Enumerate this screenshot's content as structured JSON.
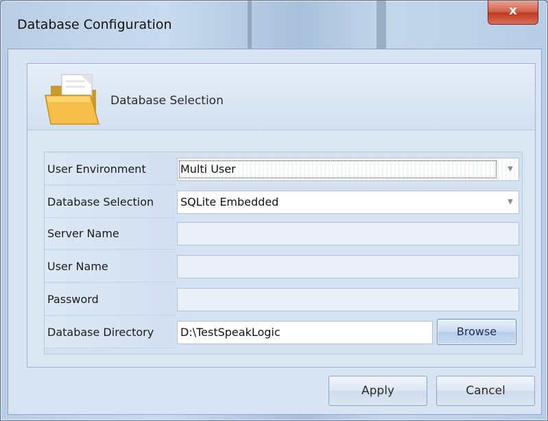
{
  "window": {
    "title": "Database Configuration",
    "close_glyph": "x"
  },
  "group": {
    "title": "Database Selection",
    "icon": "folder-icon"
  },
  "form": {
    "user_environment": {
      "label": "User Environment",
      "value": "Multi User"
    },
    "database_selection": {
      "label": "Database Selection",
      "value": "SQLite Embedded"
    },
    "server_name": {
      "label": "Server Name",
      "value": ""
    },
    "user_name": {
      "label": "User Name",
      "value": ""
    },
    "password": {
      "label": "Password",
      "value": ""
    },
    "database_directory": {
      "label": "Database Directory",
      "value": "D:\\TestSpeakLogic"
    },
    "browse_label": "Browse"
  },
  "buttons": {
    "apply": "Apply",
    "cancel": "Cancel"
  },
  "colors": {
    "close_button": "#c9442c",
    "accent_border": "#6d8fba"
  }
}
